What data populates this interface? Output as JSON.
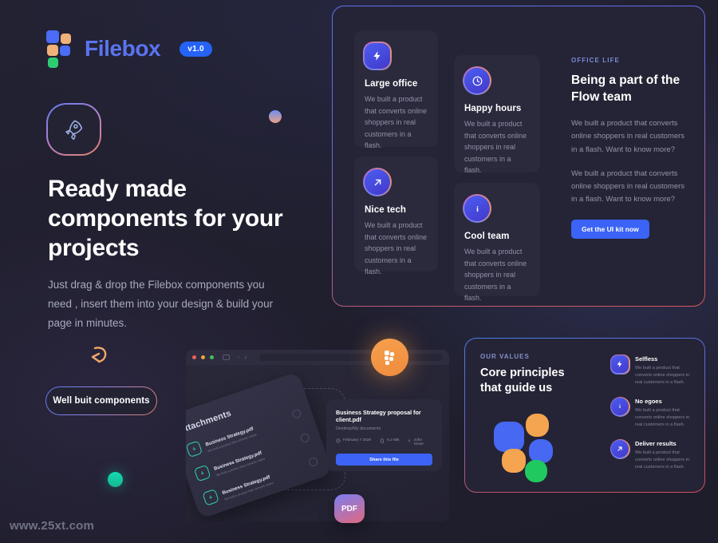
{
  "brand": {
    "name": "Filebox",
    "version_badge": "v1.0",
    "logo_icon": "filebox-blocks-logo"
  },
  "hero": {
    "rocket_icon": "rocket-icon",
    "heading": "Ready made components for your projects",
    "paragraph": "Just drag & drop the Filebox components you need , insert them into your design & build your page in minutes.",
    "arrow_icon": "curved-arrow-icon",
    "pill_button": "Well buit components"
  },
  "features_panel": {
    "cards": [
      {
        "icon": "lightning-bolt-icon",
        "title": "Large office",
        "desc": "We built a product that converts online shoppers in real customers in a flash."
      },
      {
        "icon": "clock-icon",
        "title": "Happy hours",
        "desc": "We built a product that converts online shoppers in real customers in a flash."
      },
      {
        "icon": "arrow-up-right-icon",
        "title": "Nice tech",
        "desc": "We built a product that converts online shoppers in real customers in a flash."
      },
      {
        "icon": "info-icon",
        "title": "Cool team",
        "desc": "We built a product that converts online shoppers in real customers in a flash."
      }
    ],
    "side": {
      "eyebrow": "OFFICE LIFE",
      "heading": "Being a part of the Flow team",
      "paragraph_1": "We built a product that converts online shoppers in real customers in a flash. Want to know more?",
      "paragraph_2": "We built a product that converts online shoppers in real customers in a flash. Want to know more?",
      "cta_label": "Get the UI kit now"
    }
  },
  "values_panel": {
    "eyebrow": "OUR VALUES",
    "heading": "Core principles that guide us",
    "blob_icon": "filebox-blocks-logo-large",
    "items": [
      {
        "icon": "lightning-bolt-icon",
        "title": "Selfless",
        "desc": "We built a product that converts online shoppers in real customers in a flash."
      },
      {
        "icon": "info-icon",
        "title": "No egoes",
        "desc": "We built a product that converts online shoppers in real customers in a flash."
      },
      {
        "icon": "arrow-up-right-icon",
        "title": "Deliver results",
        "desc": "We built a product that converts online shoppers in real customers in a flash."
      }
    ]
  },
  "browser_mock": {
    "attachments_label": "Attachments",
    "attachment_rows": [
      {
        "name": "Business Strategy.pdf",
        "sub": "We built a product that\nconverts online"
      },
      {
        "name": "Business Strategy.pdf",
        "sub": "We built a product that\nconverts online"
      },
      {
        "name": "Business Strategy.pdf",
        "sub": "We built a product that\nconverts online"
      }
    ],
    "file_detail": {
      "name": "Business Strategy proposal for client.pdf",
      "path": "Desktop/My documents",
      "date": "February 7 2020",
      "size": "5.2 MB",
      "owner": "John Snow",
      "share_label": "Share this file"
    },
    "orb_icon": "filebox-blocks-logo",
    "pdf_badge": "PDF"
  },
  "colors": {
    "background": "#222132",
    "accent_blue": "#3b63f6",
    "brand_blue": "#5a74f0",
    "orange": "#f0b27a",
    "green": "#2ecc71",
    "panel": "#252436",
    "card": "#2b2a3d"
  },
  "watermark": "www.25xt.com"
}
